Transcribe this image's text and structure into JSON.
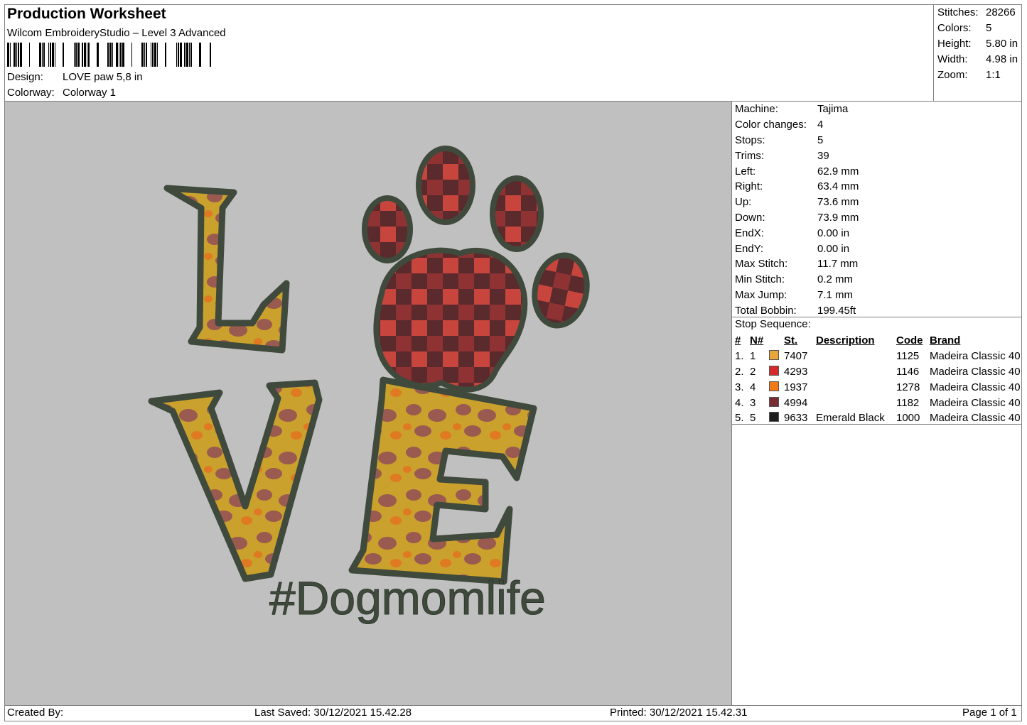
{
  "header": {
    "title": "Production Worksheet",
    "software": "Wilcom EmbroideryStudio – Level 3 Advanced",
    "design_label": "Design:",
    "design_value": "LOVE paw 5,8 in",
    "colorway_label": "Colorway:",
    "colorway_value": "Colorway 1"
  },
  "summary": [
    {
      "label": "Stitches:",
      "value": "28266"
    },
    {
      "label": "Colors:",
      "value": "5"
    },
    {
      "label": "Height:",
      "value": "5.80 in"
    },
    {
      "label": "Width:",
      "value": "4.98 in"
    },
    {
      "label": "Zoom:",
      "value": "1:1"
    }
  ],
  "machine_info": [
    {
      "label": "Machine:",
      "value": "Tajima"
    },
    {
      "label": "Color changes:",
      "value": "4"
    },
    {
      "label": "Stops:",
      "value": "5"
    },
    {
      "label": "Trims:",
      "value": "39"
    },
    {
      "label": "Left:",
      "value": "62.9 mm"
    },
    {
      "label": "Right:",
      "value": "63.4 mm"
    },
    {
      "label": "Up:",
      "value": "73.6 mm"
    },
    {
      "label": "Down:",
      "value": "73.9 mm"
    },
    {
      "label": "EndX:",
      "value": "0.00 in"
    },
    {
      "label": "EndY:",
      "value": "0.00 in"
    },
    {
      "label": "Max Stitch:",
      "value": "11.7 mm"
    },
    {
      "label": "Min Stitch:",
      "value": "0.2 mm"
    },
    {
      "label": "Max Jump:",
      "value": "7.1 mm"
    },
    {
      "label": "Total Bobbin:",
      "value": "199.45ft"
    }
  ],
  "stop_sequence": {
    "title": "Stop Sequence:",
    "headers": [
      "#",
      "N#",
      "St.",
      "Description",
      "Code",
      "Brand"
    ],
    "rows": [
      {
        "num": "1.",
        "n": "1",
        "color": "#E8A53A",
        "st": "7407",
        "desc": "",
        "code": "1125",
        "brand": "Madeira Classic 40"
      },
      {
        "num": "2.",
        "n": "2",
        "color": "#D42A2A",
        "st": "4293",
        "desc": "",
        "code": "1146",
        "brand": "Madeira Classic 40"
      },
      {
        "num": "3.",
        "n": "4",
        "color": "#F07A1A",
        "st": "1937",
        "desc": "",
        "code": "1278",
        "brand": "Madeira Classic 40"
      },
      {
        "num": "4.",
        "n": "3",
        "color": "#7A2A35",
        "st": "4994",
        "desc": "",
        "code": "1182",
        "brand": "Madeira Classic 40"
      },
      {
        "num": "5.",
        "n": "5",
        "color": "#1E1E1E",
        "st": "9633",
        "desc": "Emerald Black",
        "code": "1000",
        "brand": "Madeira Classic 40"
      }
    ]
  },
  "design_text": "#Dogmomlife",
  "footer": {
    "created_by": "Created By:",
    "last_saved": "Last Saved: 30/12/2021 15.42.28",
    "printed": "Printed: 30/12/2021 15.42.31",
    "page": "Page 1 of 1"
  }
}
